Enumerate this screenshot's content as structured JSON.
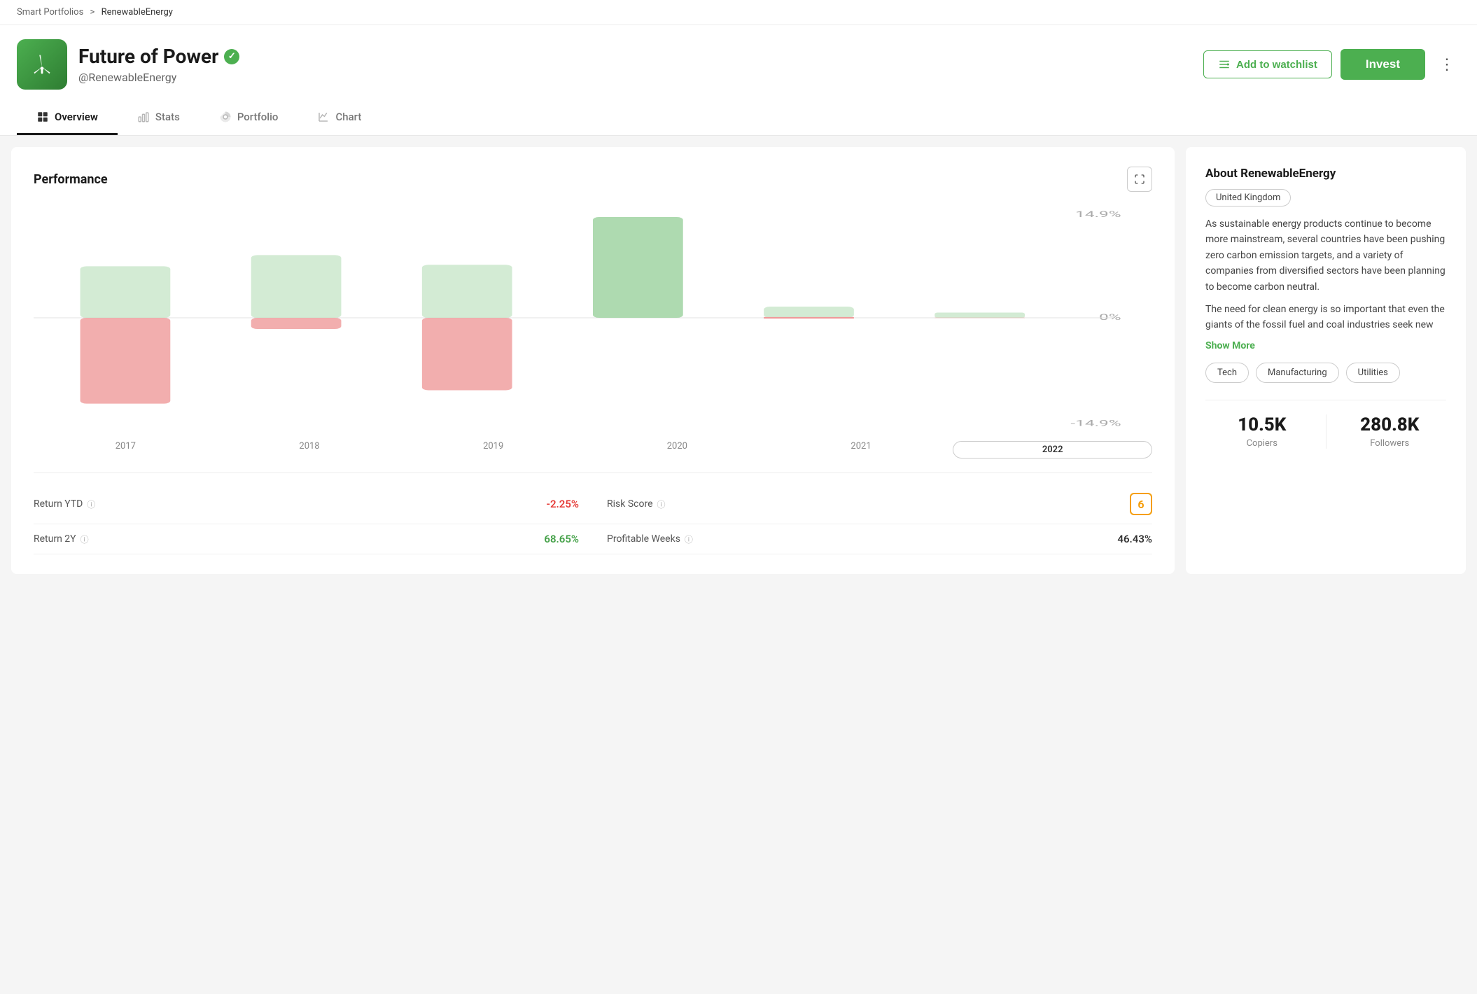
{
  "breadcrumb": {
    "parent": "Smart Portfolios",
    "separator": ">",
    "current": "RenewableEnergy"
  },
  "header": {
    "title": "Future of Power",
    "verified": true,
    "handle": "@RenewableEnergy",
    "watchlist_btn": "Add to watchlist",
    "invest_btn": "Invest"
  },
  "tabs": [
    {
      "id": "overview",
      "label": "Overview",
      "active": true
    },
    {
      "id": "stats",
      "label": "Stats",
      "active": false
    },
    {
      "id": "portfolio",
      "label": "Portfolio",
      "active": false
    },
    {
      "id": "chart",
      "label": "Chart",
      "active": false
    }
  ],
  "performance": {
    "title": "Performance",
    "years": [
      "2017",
      "2018",
      "2019",
      "2020",
      "2021",
      "2022"
    ],
    "active_year": "2022",
    "y_labels": [
      "14.9%",
      "0%",
      "-14.9%"
    ],
    "bars": [
      {
        "year": "2017",
        "positive": 45,
        "negative": -95
      },
      {
        "year": "2018",
        "positive": 62,
        "negative": -10
      },
      {
        "year": "2019",
        "positive": 52,
        "negative": -72
      },
      {
        "year": "2020",
        "positive": 100,
        "negative": 0
      },
      {
        "year": "2021",
        "positive": 18,
        "negative": 0
      },
      {
        "year": "2022",
        "positive": 5,
        "negative": 0
      }
    ]
  },
  "stats": {
    "return_ytd_label": "Return YTD",
    "return_ytd_value": "-2.25%",
    "return_ytd_type": "negative",
    "return_2y_label": "Return 2Y",
    "return_2y_value": "68.65%",
    "return_2y_type": "positive",
    "risk_score_label": "Risk Score",
    "risk_score_value": "6",
    "profitable_weeks_label": "Profitable Weeks",
    "profitable_weeks_value": "46.43%"
  },
  "about": {
    "title": "About RenewableEnergy",
    "country": "United Kingdom",
    "description1": "As sustainable energy products continue to become more mainstream, several countries have been pushing zero carbon emission targets, and a variety of companies from diversified sectors have been planning to become carbon neutral.",
    "description2": "The need for clean energy is so important that even the giants of the fossil fuel and coal industries seek new",
    "show_more": "Show More",
    "tags": [
      "Tech",
      "Manufacturing",
      "Utilities"
    ]
  },
  "social": {
    "copiers_value": "10.5K",
    "copiers_label": "Copiers",
    "followers_value": "280.8K",
    "followers_label": "Followers"
  }
}
